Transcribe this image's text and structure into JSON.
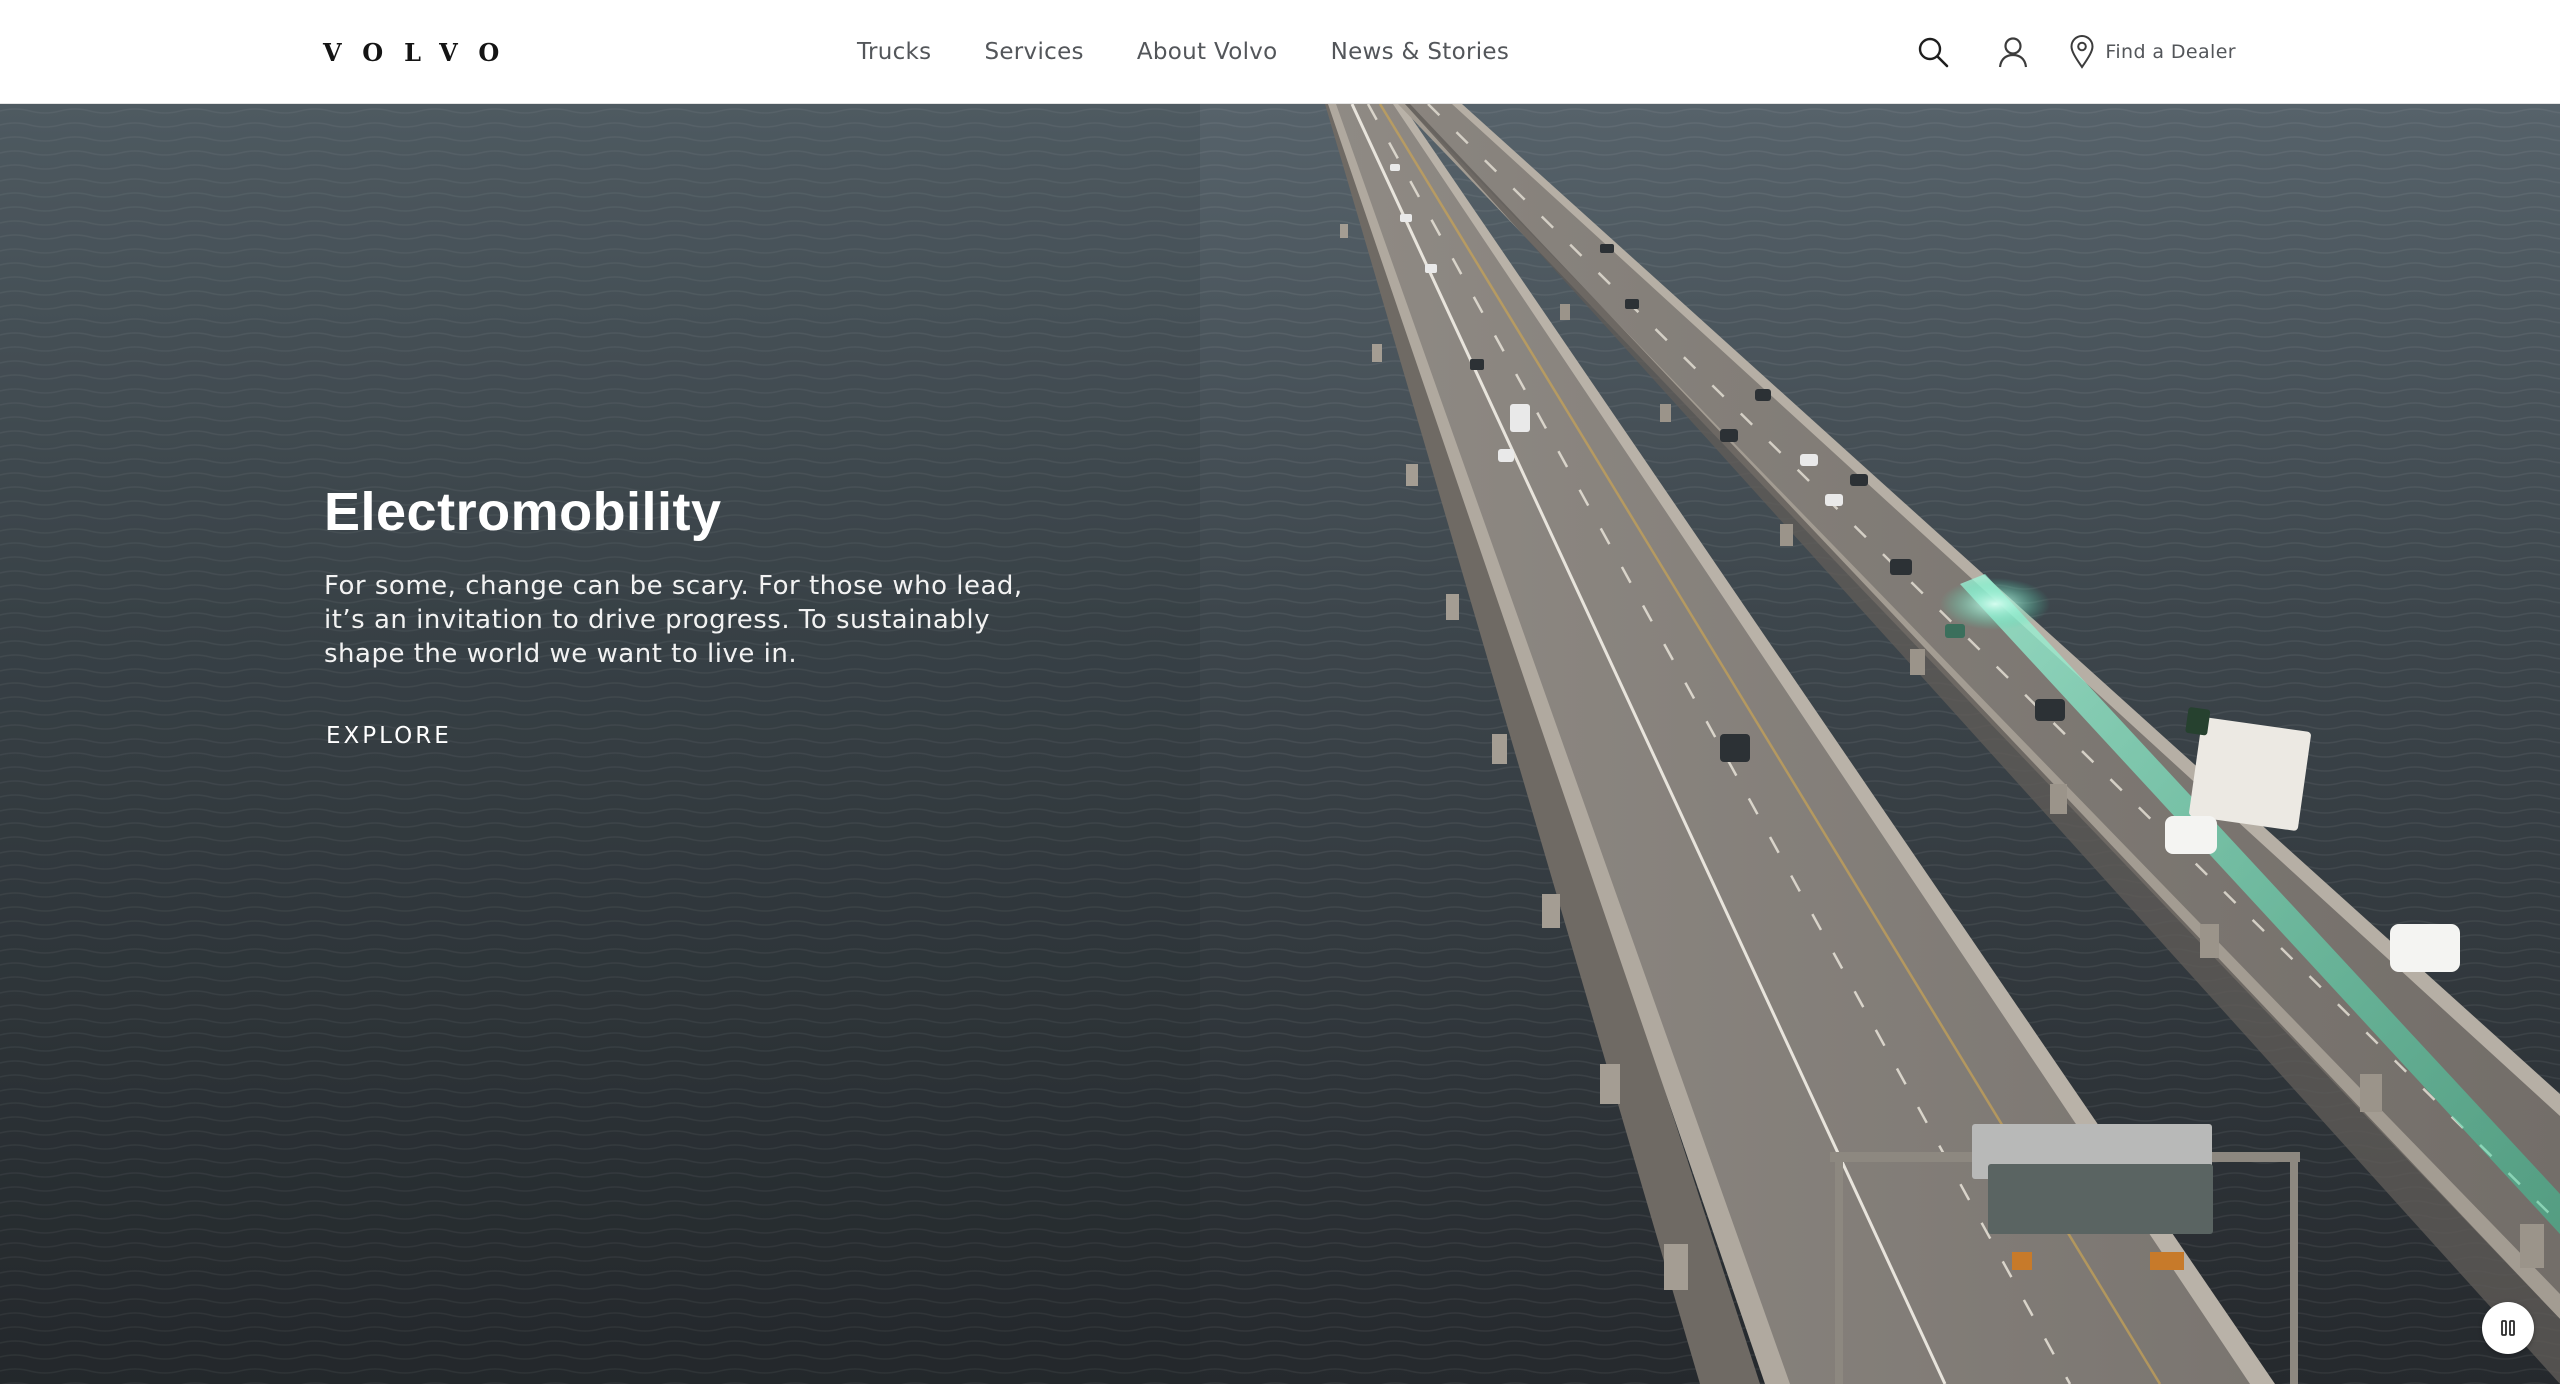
{
  "header": {
    "logo_text": "VOLVO",
    "nav": [
      {
        "label": "Trucks"
      },
      {
        "label": "Services"
      },
      {
        "label": "About Volvo"
      },
      {
        "label": "News & Stories"
      }
    ],
    "search_icon": "search-icon",
    "account_icon": "user-icon",
    "dealer": {
      "icon": "location-pin-icon",
      "label": "Find a Dealer"
    }
  },
  "hero": {
    "title": "Electromobility",
    "text": "For some, change can be scary. For those who lead, it’s an invitation to drive progress. To sustainably shape the world we want to live in.",
    "cta": "EXPLORE",
    "background_description_icon": "hero-video",
    "pause_icon": "pause-icon"
  },
  "colors": {
    "header_bg": "#ffffff",
    "nav_text": "#53565a",
    "hero_text": "#ffffff",
    "water": "#3a4349",
    "electric_glow": "#3fe0b0"
  }
}
